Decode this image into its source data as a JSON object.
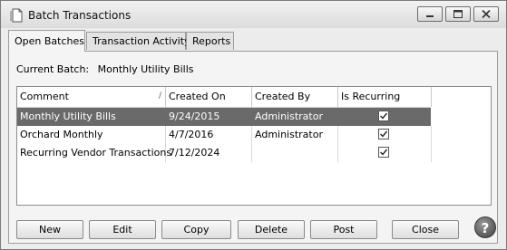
{
  "window": {
    "title": "Batch Transactions",
    "icon": "document-icon"
  },
  "tabs": [
    {
      "label": "Open Batches",
      "active": true
    },
    {
      "label": "Transaction Activity",
      "active": false
    },
    {
      "label": "Reports",
      "active": false
    }
  ],
  "current_batch": {
    "label": "Current Batch:",
    "value": "Monthly Utility Bills"
  },
  "grid": {
    "columns": [
      "Comment",
      "Created On",
      "Created By",
      "Is Recurring"
    ],
    "sort_icon": "/",
    "rows": [
      {
        "comment": "Monthly Utility Bills",
        "created_on": "9/24/2015",
        "created_by": "Administrator",
        "is_recurring": true,
        "selected": true
      },
      {
        "comment": "Orchard Monthly",
        "created_on": "4/7/2016",
        "created_by": "Administrator",
        "is_recurring": true,
        "selected": false
      },
      {
        "comment": "Recurring Vendor Transactions",
        "created_on": "7/12/2024",
        "created_by": "",
        "is_recurring": true,
        "selected": false
      }
    ]
  },
  "buttons": {
    "new": "New",
    "edit": "Edit",
    "copy": "Copy",
    "delete": "Delete",
    "post": "Post",
    "close": "Close",
    "help": "?"
  },
  "colors": {
    "selected_row": "#6a6a6a",
    "window_bg": "#ececec"
  }
}
